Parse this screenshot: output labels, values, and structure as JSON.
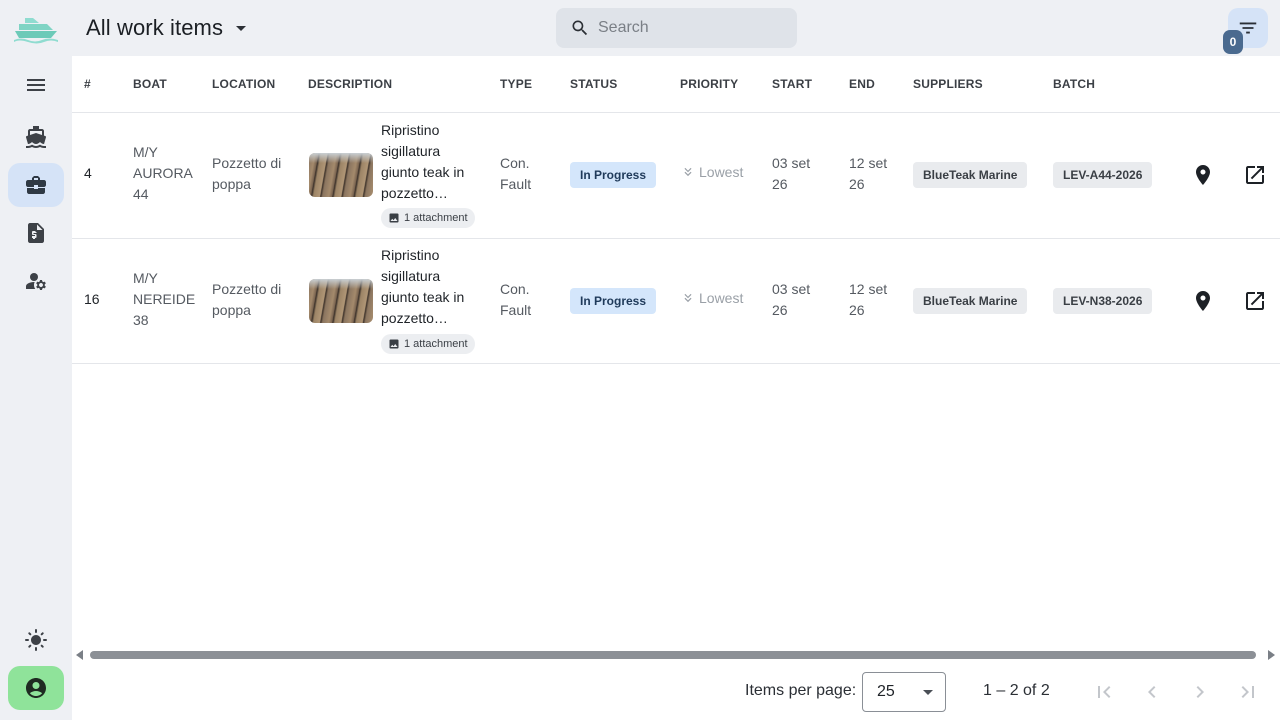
{
  "header": {
    "title": "All work items",
    "search_placeholder": "Search",
    "filter_count": "0"
  },
  "columns": [
    "#",
    "BOAT",
    "LOCATION",
    "DESCRIPTION",
    "TYPE",
    "STATUS",
    "PRIORITY",
    "START",
    "END",
    "SUPPLIERS",
    "BATCH"
  ],
  "rows": [
    {
      "id": "4",
      "boat_l1": "M/Y",
      "boat_l2": "AURORA",
      "boat_l3": "44",
      "location_l1": "Pozzetto di",
      "location_l2": "poppa",
      "desc_l1": "Ripristino",
      "desc_l2": "sigillatura",
      "desc_l3": "giunto teak in",
      "desc_l4": "pozzetto…",
      "attachments": "1 attachment",
      "type_l1": "Con.",
      "type_l2": "Fault",
      "status": "In Progress",
      "priority": "Lowest",
      "start_l1": "03 set",
      "start_l2": "26",
      "end_l1": "12 set",
      "end_l2": "26",
      "supplier": "BlueTeak Marine",
      "batch": "LEV-A44-2026"
    },
    {
      "id": "16",
      "boat_l1": "M/Y",
      "boat_l2": "NEREIDE",
      "boat_l3": "38",
      "location_l1": "Pozzetto di",
      "location_l2": "poppa",
      "desc_l1": "Ripristino",
      "desc_l2": "sigillatura",
      "desc_l3": "giunto teak in",
      "desc_l4": "pozzetto…",
      "attachments": "1 attachment",
      "type_l1": "Con.",
      "type_l2": "Fault",
      "status": "In Progress",
      "priority": "Lowest",
      "start_l1": "03 set",
      "start_l2": "26",
      "end_l1": "12 set",
      "end_l2": "26",
      "supplier": "BlueTeak Marine",
      "batch": "LEV-N38-2026"
    }
  ],
  "paginator": {
    "items_per_page_label": "Items per page:",
    "page_size": "25",
    "range": "1 – 2 of 2"
  },
  "colors": {
    "accent": "#d5e3f7",
    "status_bg": "#d4e6fb",
    "account": "#8fe39a",
    "logo": "#7fd4c4"
  },
  "icons": {
    "rail": [
      "menu-icon",
      "ship-icon",
      "briefcase-icon",
      "invoice-icon",
      "user-settings-icon",
      "brightness-icon",
      "account-icon"
    ],
    "row_actions": [
      "location-pin-icon",
      "open-in-new-icon"
    ]
  }
}
